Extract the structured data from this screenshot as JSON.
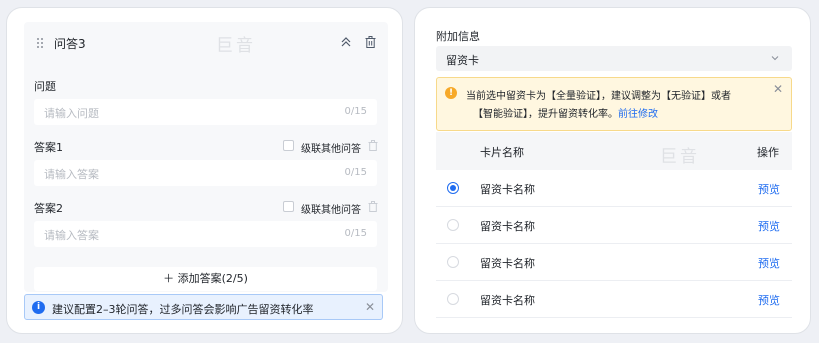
{
  "left": {
    "qa_title": "问答3",
    "watermark": "巨音",
    "question_label": "问题",
    "question_placeholder": "请输入问题",
    "question_count": "0/15",
    "answers": [
      {
        "label": "答案1",
        "cascade_label": "级联其他问答",
        "placeholder": "请输入答案",
        "count": "0/15"
      },
      {
        "label": "答案2",
        "cascade_label": "级联其他问答",
        "placeholder": "请输入答案",
        "count": "0/15"
      }
    ],
    "add_answer": "＋ 添加答案(2/5)",
    "info_icon": "i",
    "info_text": "建议配置2–3轮问答，过多问答会影响广告留资转化率",
    "close_glyph": "✕"
  },
  "right": {
    "section_title": "附加信息",
    "select_value": "留资卡",
    "warning": {
      "icon": "!",
      "line1": "当前选中留资卡为【全量验证】，建议调整为【无验证】或者",
      "line2": "【智能验证】，提升留资转化率。",
      "link": "前往修改",
      "close_glyph": "✕"
    },
    "watermark": "巨音",
    "table": {
      "col_name": "卡片名称",
      "col_op": "操作",
      "rows": [
        {
          "name": "留资卡名称",
          "action": "预览",
          "selected": true
        },
        {
          "name": "留资卡名称",
          "action": "预览",
          "selected": false
        },
        {
          "name": "留资卡名称",
          "action": "预览",
          "selected": false
        },
        {
          "name": "留资卡名称",
          "action": "预览",
          "selected": false
        }
      ]
    }
  },
  "colors": {
    "accent": "#1f6cf0",
    "warning": "#f7a928",
    "info_bg": "#e8f1fe",
    "warn_bg": "#fff7e0"
  },
  "icons": [
    "drag-handle-icon",
    "collapse-icon",
    "trash-icon",
    "info-icon",
    "close-icon",
    "chevron-down-icon",
    "warning-icon",
    "radio-icon"
  ]
}
